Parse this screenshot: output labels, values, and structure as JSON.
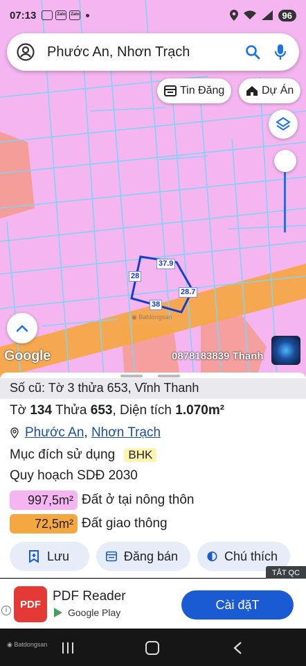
{
  "status_bar": {
    "time": "07:13",
    "notif_icons": [
      "image-icon",
      "Zalo",
      "Zalo"
    ],
    "battery": "96"
  },
  "search": {
    "query": "Phước An, Nhơn Trạch"
  },
  "map_chips": {
    "posts": "Tin Đăng",
    "projects": "Dự Án"
  },
  "plot_dimensions": {
    "top": "37.9",
    "left": "28",
    "right": "28.7",
    "bottom": "38"
  },
  "map_watermarks": {
    "google": "Google",
    "contact": "0878183839 Thanh"
  },
  "sheet": {
    "old_ref": "Số cũ: Tờ 3 thửa 653, Vĩnh Thanh",
    "sheet_label": "Tờ",
    "sheet_no": "134",
    "parcel_label": "Thửa",
    "parcel_no": "653",
    "area_label": "Diện tích",
    "area_value": "1.070m²",
    "ward": "Phước An",
    "district": "Nhơn Trạch",
    "land_use_label": "Mục đích sử dụng",
    "land_use_code": "BHK",
    "plan_title": "Quy hoạch SDĐ 2030",
    "zones": [
      {
        "area": "997,5m²",
        "label": "Đất ở tại nông thôn",
        "color": "#f4b5f0"
      },
      {
        "area": "72,5m²",
        "label": "Đất giao thông",
        "color": "#f5a742"
      }
    ],
    "actions": {
      "save": "Lưu",
      "post": "Đăng bán",
      "legend": "Chú thích"
    }
  },
  "ad": {
    "close_label": "TẮT QC",
    "app_icon_text": "PDF",
    "title": "PDF Reader",
    "store": "Google Play",
    "install": "Cài đặT"
  },
  "colors": {
    "map_bg": "#f4b5f0",
    "road": "#f5a742",
    "accent": "#1a5ad2"
  }
}
